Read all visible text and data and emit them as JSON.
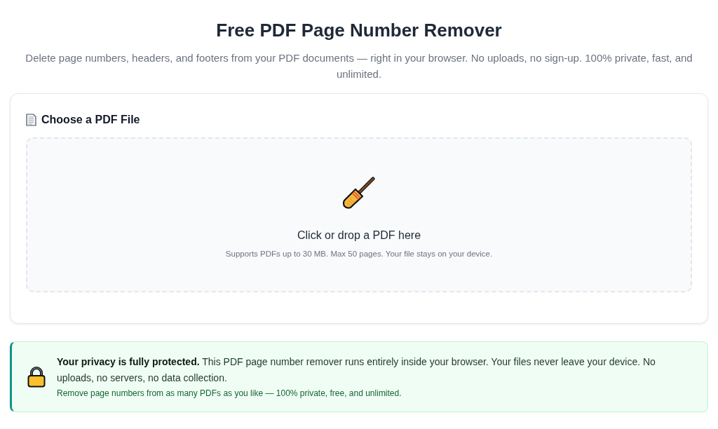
{
  "header": {
    "title": "Free PDF Page Number Remover",
    "subtitle": "Delete page numbers, headers, and footers from your PDF documents — right in your browser. No uploads, no sign-up. 100% private, fast, and unlimited."
  },
  "upload_card": {
    "title": "Choose a PDF File",
    "dropzone": {
      "prompt": "Click or drop a PDF here",
      "hint": "Supports PDFs up to 30 MB. Max 50 pages. Your file stays on your device."
    }
  },
  "privacy_notice": {
    "text": "**Your privacy is fully protected.** This PDF page number remover runs entirely inside your browser. Your files never leave your device. No uploads, no servers, no data collection.",
    "note": "Remove page numbers from as many PDFs as you like — 100% private, free, and unlimited."
  }
}
